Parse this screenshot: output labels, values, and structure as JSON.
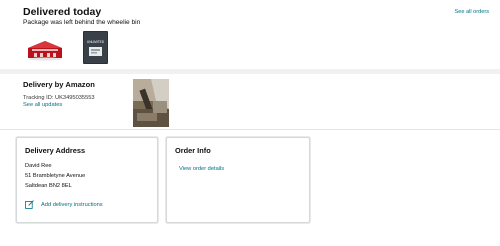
{
  "status": {
    "title": "Delivered today",
    "subtitle": "Package was left behind the wheelie bin",
    "see_all_orders": "See all orders"
  },
  "products": [
    {
      "icon": "product-image-red-building"
    },
    {
      "icon": "product-image-unlimited-book",
      "text": "UNLIMITED"
    }
  ],
  "delivery": {
    "heading": "Delivery by Amazon",
    "tracking": "Tracking ID: UK3495035553",
    "see_all_updates": "See all updates",
    "photo_icon": "delivery-photo"
  },
  "address_card": {
    "title": "Delivery Address",
    "lines": [
      "David Ree",
      "51 Brambletyne Avenue",
      "Saltdean BN2 8EL"
    ],
    "instructions_link": "Add delivery instructions"
  },
  "order_card": {
    "title": "Order Info",
    "view_details": "View order details"
  },
  "colors": {
    "link": "#007185",
    "text": "#0f1111",
    "border": "#d5d9d9",
    "divider": "#f0f2f2",
    "product_red": "#c8202a"
  }
}
